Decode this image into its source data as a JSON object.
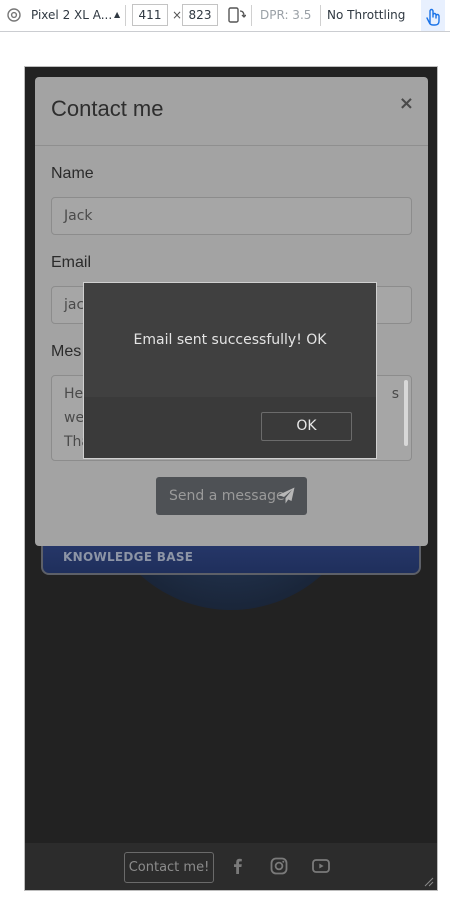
{
  "devtools": {
    "device": "Pixel 2 XL A...",
    "width": "411",
    "times": "×",
    "height": "823",
    "dpr": "DPR: 3.5",
    "throttling": "No Throttling"
  },
  "page": {
    "knowledge_base": "KNOWLEDGE BASE",
    "footer": {
      "contact_button": "Contact me!",
      "icons": [
        "facebook-icon",
        "instagram-icon",
        "youtube-icon"
      ]
    }
  },
  "modal": {
    "title": "Contact me",
    "close": "×",
    "name_label": "Name",
    "name_value": "Jack",
    "email_label": "Email",
    "email_value": "jac",
    "message_label": "Mes",
    "message_value": "He\nwe\nTha",
    "message_trailing": "s",
    "send_label": "Send a message"
  },
  "alert": {
    "message": "Email sent successfully! OK",
    "ok_label": "OK"
  }
}
